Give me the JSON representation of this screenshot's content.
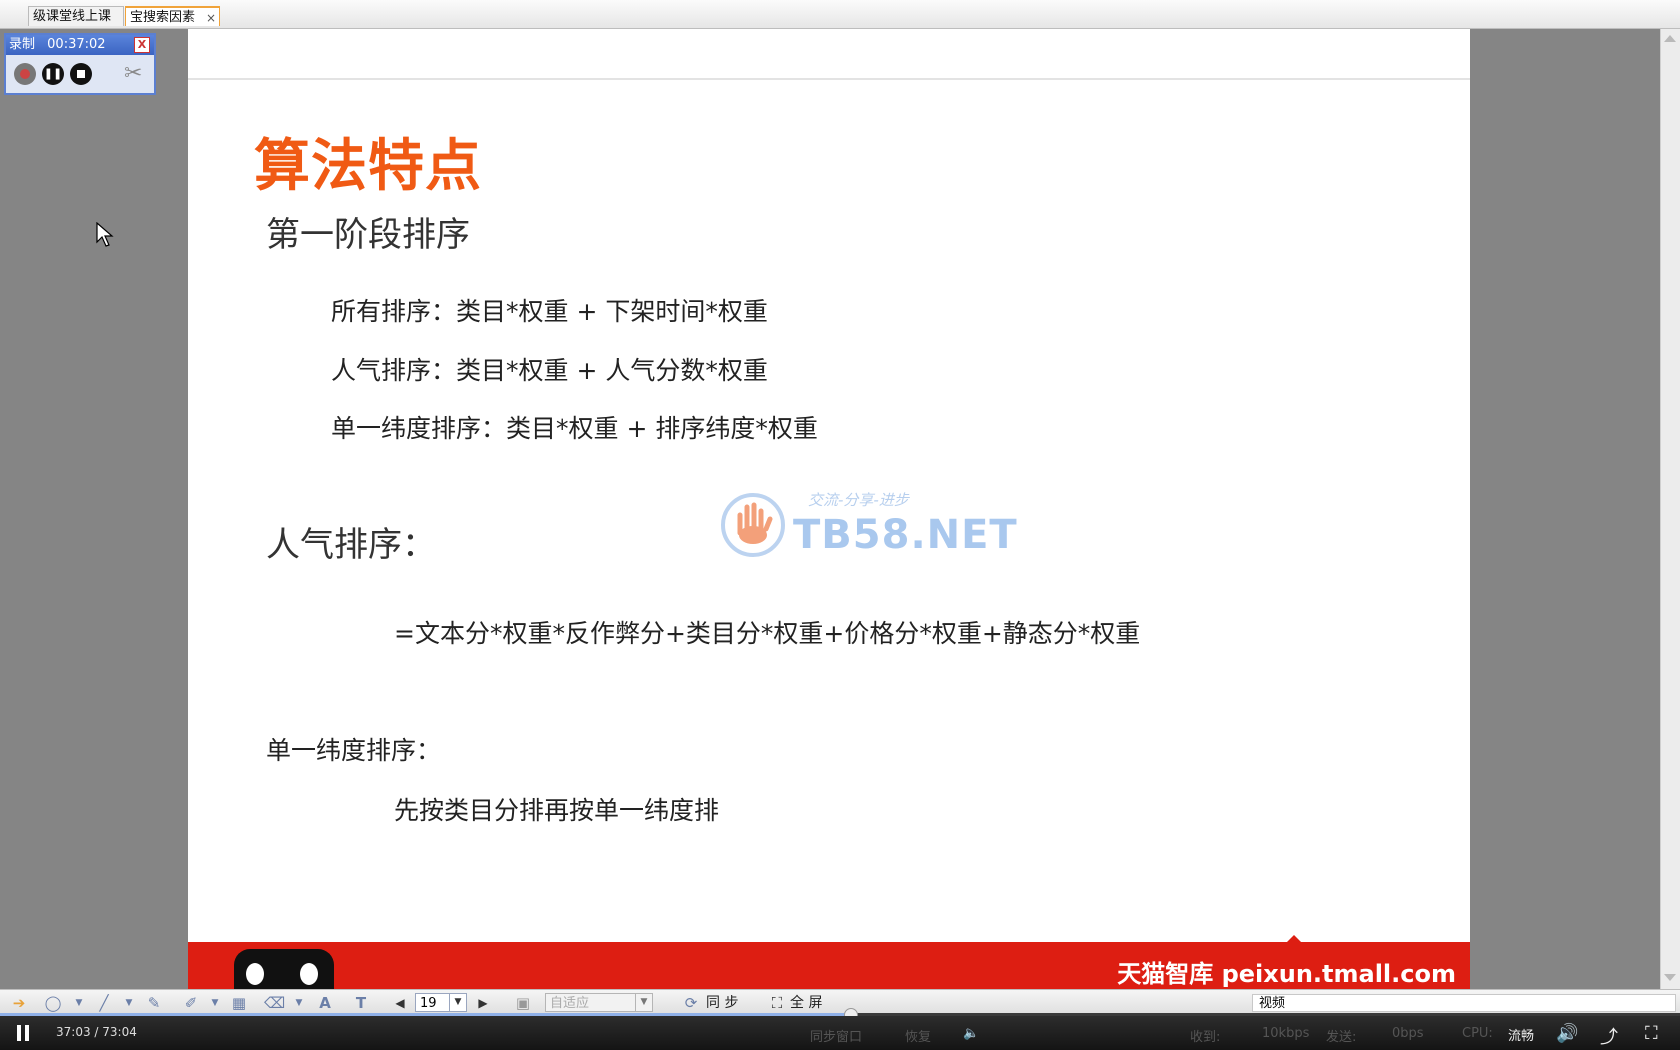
{
  "tabs": [
    {
      "label": "级课堂线上课"
    },
    {
      "label": "宝搜索因素",
      "close": "×"
    }
  ],
  "recorder": {
    "title": "录制",
    "time": "00:37:02",
    "close": "X"
  },
  "slide": {
    "title": "算法特点",
    "section1": "第一阶段排序",
    "line1": "所有排序：类目*权重 + 下架时间*权重",
    "line2": "人气排序：类目*权重 + 人气分数*权重",
    "line3": "单一纬度排序：类目*权重 + 排序纬度*权重",
    "section2": "人气排序：",
    "formula": "=文本分*权重*反作弊分+类目分*权重+价格分*权重+静态分*权重",
    "section3": "单一纬度排序：",
    "line4": "先按类目分排再按单一纬度排",
    "watermark": "TB58.NET",
    "watermark_sub": "交流-分享-进步",
    "banner": "天猫智库 peixun.tmall.com"
  },
  "toolbar": {
    "page": "19",
    "zoom": "自适应",
    "sync": "同 步",
    "fullscreen": "全 屏",
    "video_label": "视频"
  },
  "player": {
    "time": "37:03 / 73:04",
    "progress": 0.506,
    "sync_window": "同步窗口",
    "restore": "恢复",
    "recv_label": "收到:",
    "recv_value": "10kbps",
    "send_label": "发送:",
    "send_value": "0bps",
    "cpu_label": "CPU:",
    "quality": "流畅"
  }
}
